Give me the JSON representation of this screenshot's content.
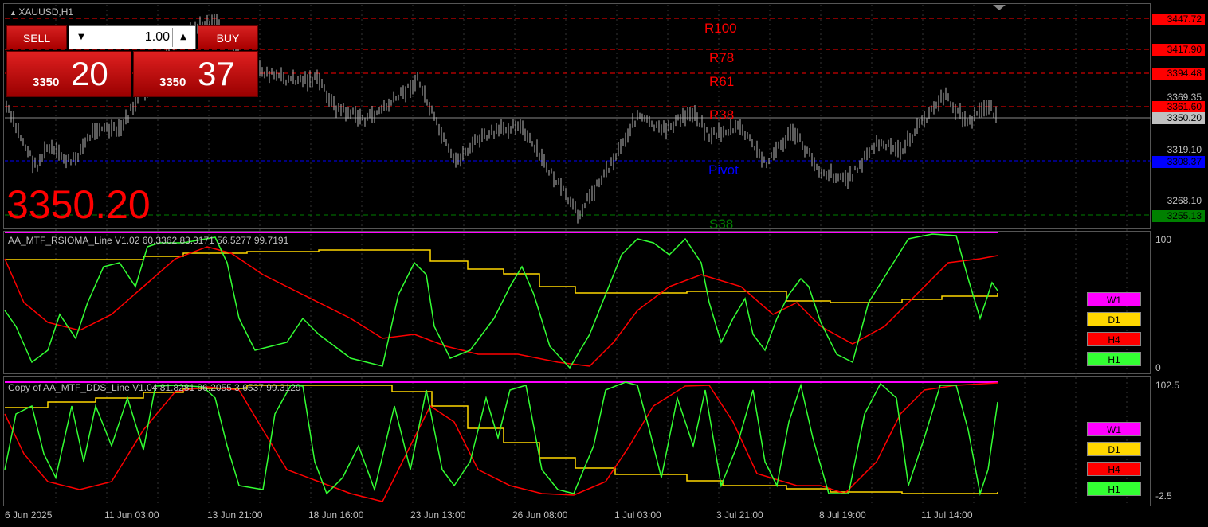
{
  "chart_title": "XAUUSD,H1",
  "trade_panel": {
    "sell_label": "SELL",
    "buy_label": "BUY",
    "lot": "1.00",
    "sell_price_small": "3350",
    "sell_price_big": "20",
    "buy_price_small": "3350",
    "buy_price_big": "37"
  },
  "current_price_big": "3350.20",
  "levels": {
    "r100": "R100",
    "r78": "R78",
    "r61": "R61",
    "r38": "R38",
    "pivot": "Pivot",
    "s38": "S38"
  },
  "price_axis": {
    "p1": "3447.72",
    "p2": "3417.90",
    "p3": "3394.48",
    "p4": "3369.35",
    "p5": "3361.60",
    "p6": "3350.20",
    "p7": "3319.10",
    "p8": "3308.37",
    "p9": "3268.10",
    "p10": "3255.13"
  },
  "indicator1": {
    "title": "AA_MTF_RSIOMA_Line V1.02 60.3362 83.3171 56.5277 99.7191",
    "axis_top": "100",
    "axis_bottom": "0"
  },
  "indicator2": {
    "title": "Copy of AA_MTF_DDS_Line V1.04 81.8281 96.2055 3.6537 99.3129",
    "axis_top": "102.5",
    "axis_bottom": "-2.5"
  },
  "legend": {
    "w1": "W1",
    "d1": "D1",
    "h4": "H4",
    "h1": "H1"
  },
  "time_axis": [
    "6 Jun 2025",
    "11 Jun 03:00",
    "13 Jun 21:00",
    "18 Jun 16:00",
    "23 Jun 13:00",
    "26 Jun 08:00",
    "1 Jul 03:00",
    "3 Jul 21:00",
    "8 Jul 19:00",
    "11 Jul 14:00"
  ],
  "colors": {
    "w1": "#ff00ff",
    "d1": "#ffd700",
    "h4": "#ff0000",
    "h1": "#33ff33",
    "resistance": "#ff0000",
    "pivot": "#0000ff",
    "support": "#008000"
  }
}
